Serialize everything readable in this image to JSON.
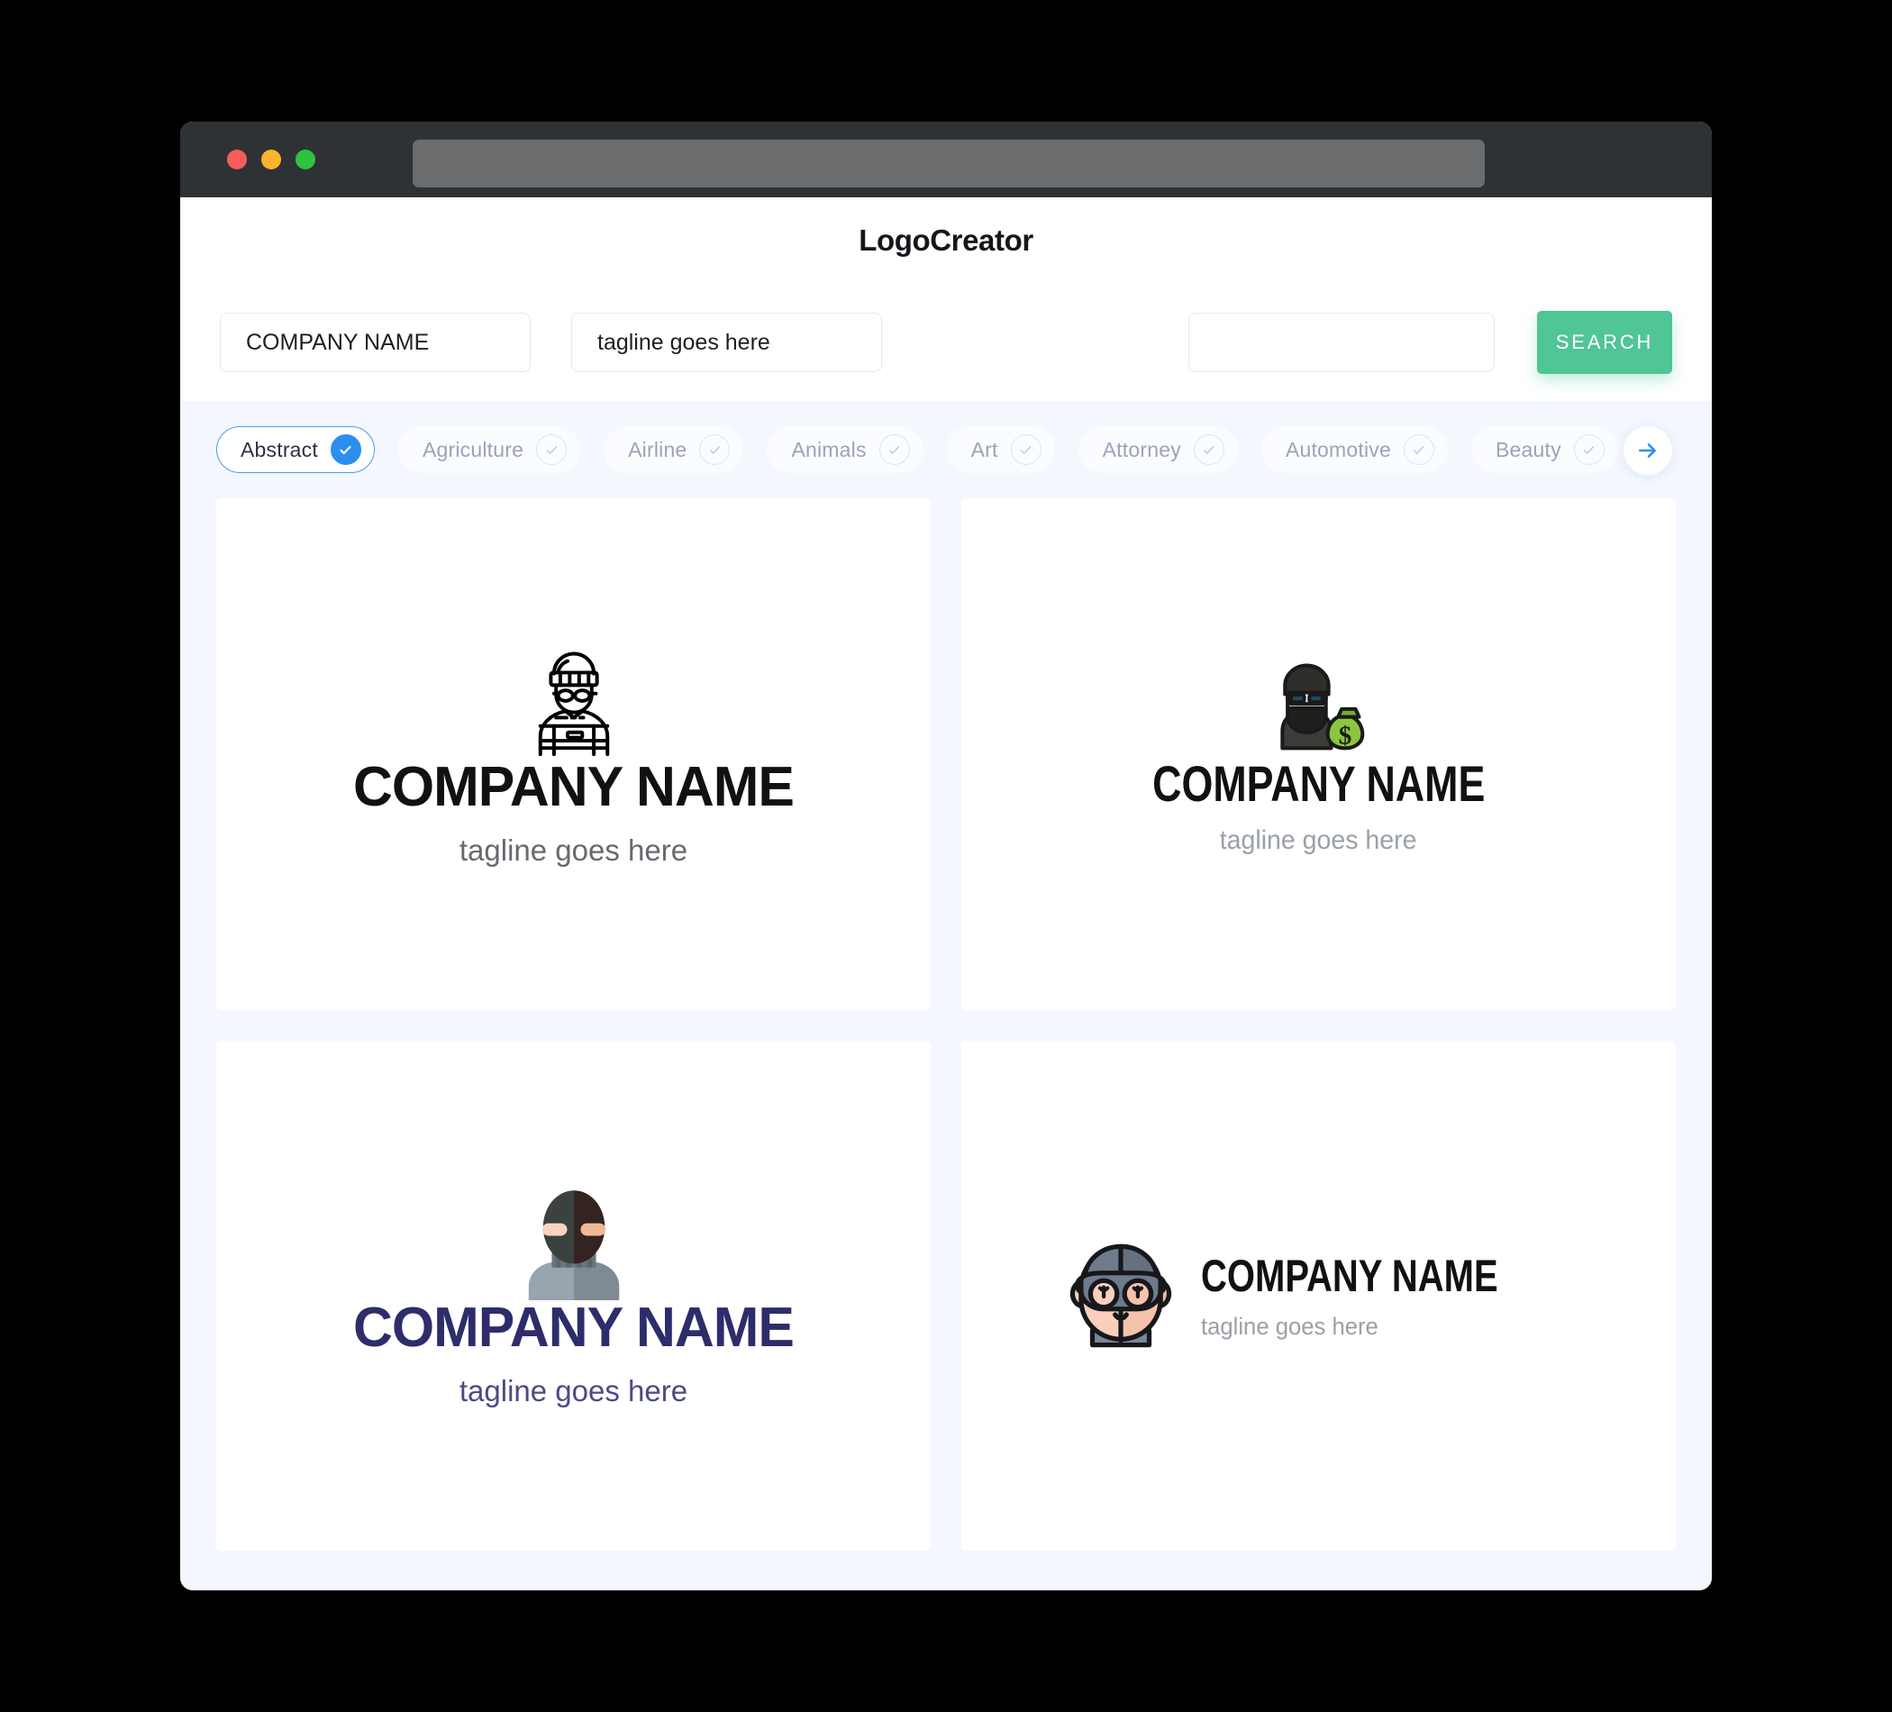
{
  "browser": {
    "url_value": "",
    "url_placeholder": "",
    "traffic_lights": [
      {
        "name": "close",
        "color": "#f85b5b"
      },
      {
        "name": "minimize",
        "color": "#f9b42c"
      },
      {
        "name": "maximize",
        "color": "#2ec23f"
      }
    ]
  },
  "header": {
    "title": "LogoCreator"
  },
  "search": {
    "company_value": "COMPANY NAME",
    "company_placeholder": "COMPANY NAME",
    "tagline_value": "tagline goes here",
    "tagline_placeholder": "tagline goes here",
    "extra_value": "",
    "extra_placeholder": "",
    "button_label": "SEARCH",
    "button_color": "#50c596"
  },
  "categories": {
    "selected": "Abstract",
    "accent_color": "#2b8ff0",
    "next_icon": "arrow-right-icon",
    "items": [
      {
        "label": "Abstract",
        "selected": true
      },
      {
        "label": "Agriculture",
        "selected": false
      },
      {
        "label": "Airline",
        "selected": false
      },
      {
        "label": "Animals",
        "selected": false
      },
      {
        "label": "Art",
        "selected": false
      },
      {
        "label": "Attorney",
        "selected": false
      },
      {
        "label": "Automotive",
        "selected": false
      },
      {
        "label": "Beauty",
        "selected": false
      }
    ]
  },
  "logos": [
    {
      "id": "logo-1",
      "icon": "burglar-line-icon",
      "layout": "stacked",
      "company": "COMPANY NAME",
      "tagline": "tagline goes here",
      "name_color": "#111111",
      "tagline_color": "#666a6f"
    },
    {
      "id": "logo-2",
      "icon": "robber-money-bag-icon",
      "layout": "stacked",
      "company": "COMPANY NAME",
      "tagline": "tagline goes here",
      "name_color": "#111111",
      "tagline_color": "#9aa0a6"
    },
    {
      "id": "logo-3",
      "icon": "masked-thief-flat-icon",
      "layout": "stacked",
      "company": "COMPANY NAME",
      "tagline": "tagline goes here",
      "name_color": "#2d2d6b",
      "tagline_color": "#4a4a88"
    },
    {
      "id": "logo-4",
      "icon": "cartoon-burglar-face-icon",
      "layout": "horizontal",
      "company": "COMPANY NAME",
      "tagline": "tagline goes here",
      "name_color": "#111111",
      "tagline_color": "#9aa0a6"
    }
  ]
}
